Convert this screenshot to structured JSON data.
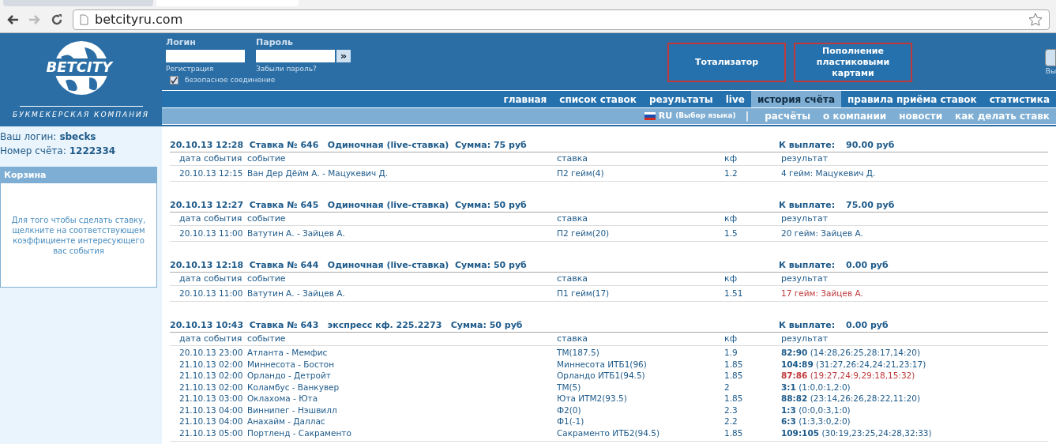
{
  "browser": {
    "address": "betcityru.com"
  },
  "login": {
    "login_label": "Логин",
    "password_label": "Пароль",
    "register_link": "Регистрация",
    "forgot_link": "Забыли пароль?",
    "secure_label": "безопасное соединение",
    "secure_checked": true,
    "submit": "»"
  },
  "logo": {
    "text": "BETCITY",
    "tagline": "БУКМЕКЕРСКАЯ КОМПАНИЯ"
  },
  "promo_buttons": [
    "Тотализатор",
    "Пополнение пластиковыми картами"
  ],
  "exit_label": "Вы",
  "main_nav": [
    {
      "label": "главная",
      "selected": false
    },
    {
      "label": "список ставок",
      "selected": false
    },
    {
      "label": "результаты",
      "selected": false
    },
    {
      "label": "live",
      "selected": false
    },
    {
      "label": "история счёта",
      "selected": true
    },
    {
      "label": "правила приёма ставок",
      "selected": false
    },
    {
      "label": "статистика",
      "selected": false
    }
  ],
  "language": {
    "code": "RU",
    "label": "(Выбор языка)",
    "separator": "|"
  },
  "sub_nav": [
    "расчёты",
    "о компании",
    "новости",
    "как делать ставк"
  ],
  "account": {
    "login_label": "Ваш логин:",
    "login": "sbecks",
    "number_label": "Номер счёта:",
    "number": "1222334"
  },
  "basket": {
    "title": "Корзина",
    "hint": "Для того чтобы сделать ставку, щелкните на соответствующем коэффициенте интересующего вас события"
  },
  "bets": [
    {
      "header": "20.10.13 12:28  Ставка № 646   Одиночная (live-ставка)  Сумма: 75 руб",
      "payout_label": "К выплате:",
      "payout": "90.00 руб",
      "columns": [
        "дата события",
        "событие",
        "ставка",
        "кф",
        "результат"
      ],
      "rows": [
        {
          "date": "20.10.13 12:15",
          "event": "Ван Дер Дёйм А. - Мацукевич Д.",
          "stake": "П2 гейм(4)",
          "odds": "1.2",
          "result": "4 гейм: Мацукевич Д.",
          "lost": false
        }
      ]
    },
    {
      "header": "20.10.13 12:27  Ставка № 645   Одиночная (live-ставка)  Сумма: 50 руб",
      "payout_label": "К выплате:",
      "payout": "75.00 руб",
      "columns": [
        "дата события",
        "событие",
        "ставка",
        "кф",
        "результат"
      ],
      "rows": [
        {
          "date": "20.10.13 11:00",
          "event": "Ватутин А. - Зайцев А.",
          "stake": "П2 гейм(20)",
          "odds": "1.5",
          "result": "20 гейм: Зайцев А.",
          "lost": false
        }
      ]
    },
    {
      "header": "20.10.13 12:18  Ставка № 644   Одиночная (live-ставка)  Сумма: 50 руб",
      "payout_label": "К выплате:",
      "payout": "0.00 руб",
      "columns": [
        "дата события",
        "событие",
        "ставка",
        "кф",
        "результат"
      ],
      "rows": [
        {
          "date": "20.10.13 11:00",
          "event": "Ватутин А. - Зайцев А.",
          "stake": "П1 гейм(17)",
          "odds": "1.51",
          "result": "17 гейм: Зайцев А.",
          "lost": true
        }
      ]
    },
    {
      "header": "20.10.13 10:43  Ставка № 643   экспресс кф. 225.2273   Сумма: 50 руб",
      "payout_label": "К выплате:",
      "payout": "0.00 руб",
      "columns": [
        "дата события",
        "событие",
        "ставка",
        "кф",
        "результат"
      ],
      "rows": [
        {
          "date": "20.10.13 23:00",
          "event": "Атланта - Мемфис",
          "stake": "ТМ(187.5)",
          "odds": "1.9",
          "result": "**82:90** (14:28,26:25,28:17,14:20)",
          "lost": false
        },
        {
          "date": "21.10.13 02:00",
          "event": "Миннесота - Бостон",
          "stake": "Миннесота ИТБ1(96)",
          "odds": "1.85",
          "result": "**104:89** (31:27,26:24,24:21,23:17)",
          "lost": false
        },
        {
          "date": "21.10.13 02:00",
          "event": "Орландо - Детройт",
          "stake": "Орландо ИТБ1(94.5)",
          "odds": "1.85",
          "result": "**87:86** (19:27,24:9,29:18,15:32)",
          "lost": true
        },
        {
          "date": "21.10.13 02:00",
          "event": "Коламбус - Ванкувер",
          "stake": "ТМ(5)",
          "odds": "2",
          "result": "**3:1** (1:0,0:1,2:0)",
          "lost": false
        },
        {
          "date": "21.10.13 03:00",
          "event": "Оклахома - Юта",
          "stake": "Юта ИТМ2(93.5)",
          "odds": "1.85",
          "result": "**88:82** (23:14,26:26,28:22,11:20)",
          "lost": false
        },
        {
          "date": "21.10.13 04:00",
          "event": "Виннипег - Нэшвилл",
          "stake": "Ф2(0)",
          "odds": "2.3",
          "result": "**1:3** (0:0,0:3,1:0)",
          "lost": false
        },
        {
          "date": "21.10.13 04:00",
          "event": "Анахайм - Даллас",
          "stake": "Ф1(-1)",
          "odds": "2.2",
          "result": "**6:3** (1:3,3:0,2:0)",
          "lost": false
        },
        {
          "date": "21.10.13 05:00",
          "event": "Портленд - Сакраменто",
          "stake": "Сакраменто ИТБ2(94.5)",
          "odds": "1.85",
          "result": "**109:105** (30:19,23:25,24:28,32:33)",
          "lost": false
        }
      ]
    }
  ]
}
